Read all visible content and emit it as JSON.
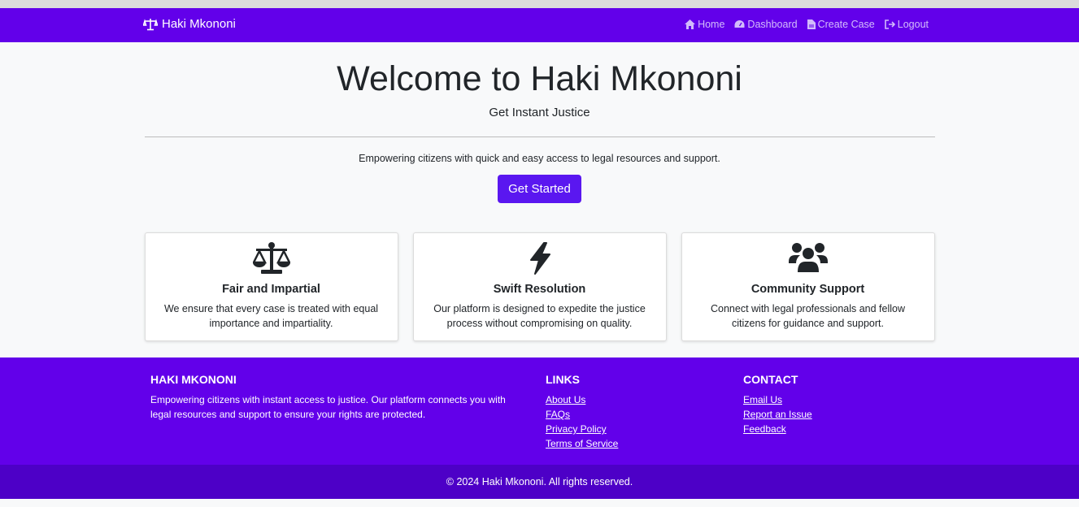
{
  "navbar": {
    "brand": "Haki Mkononi",
    "links": [
      "Home",
      "Dashboard",
      "Create Case",
      "Logout"
    ]
  },
  "hero": {
    "title": "Welcome to Haki Mkononi",
    "subtitle": "Get Instant Justice",
    "lead": "Empowering citizens with quick and easy access to legal resources and support.",
    "cta": "Get Started"
  },
  "features": [
    {
      "icon": "scale-icon",
      "title": "Fair and Impartial",
      "text": "We ensure that every case is treated with equal importance and impartiality."
    },
    {
      "icon": "bolt-icon",
      "title": "Swift Resolution",
      "text": "Our platform is designed to expedite the justice process without compromising on quality."
    },
    {
      "icon": "users-icon",
      "title": "Community Support",
      "text": "Connect with legal professionals and fellow citizens for guidance and support."
    }
  ],
  "footer": {
    "about_title": "HAKI MKONONI",
    "about_text": "Empowering citizens with instant access to justice. Our platform connects you with legal resources and support to ensure your rights are protected.",
    "links_title": "LINKS",
    "links": [
      "About Us",
      "FAQs",
      "Privacy Policy",
      "Terms of Service"
    ],
    "contact_title": "CONTACT",
    "contact": [
      "Email Us",
      "Report an Issue",
      "Feedback"
    ],
    "copyright": "© 2024 Haki Mkononi. All rights reserved."
  },
  "colors": {
    "primary": "#6200ea",
    "button": "#5a17f0",
    "footer_bottom": "#4d00c7"
  }
}
